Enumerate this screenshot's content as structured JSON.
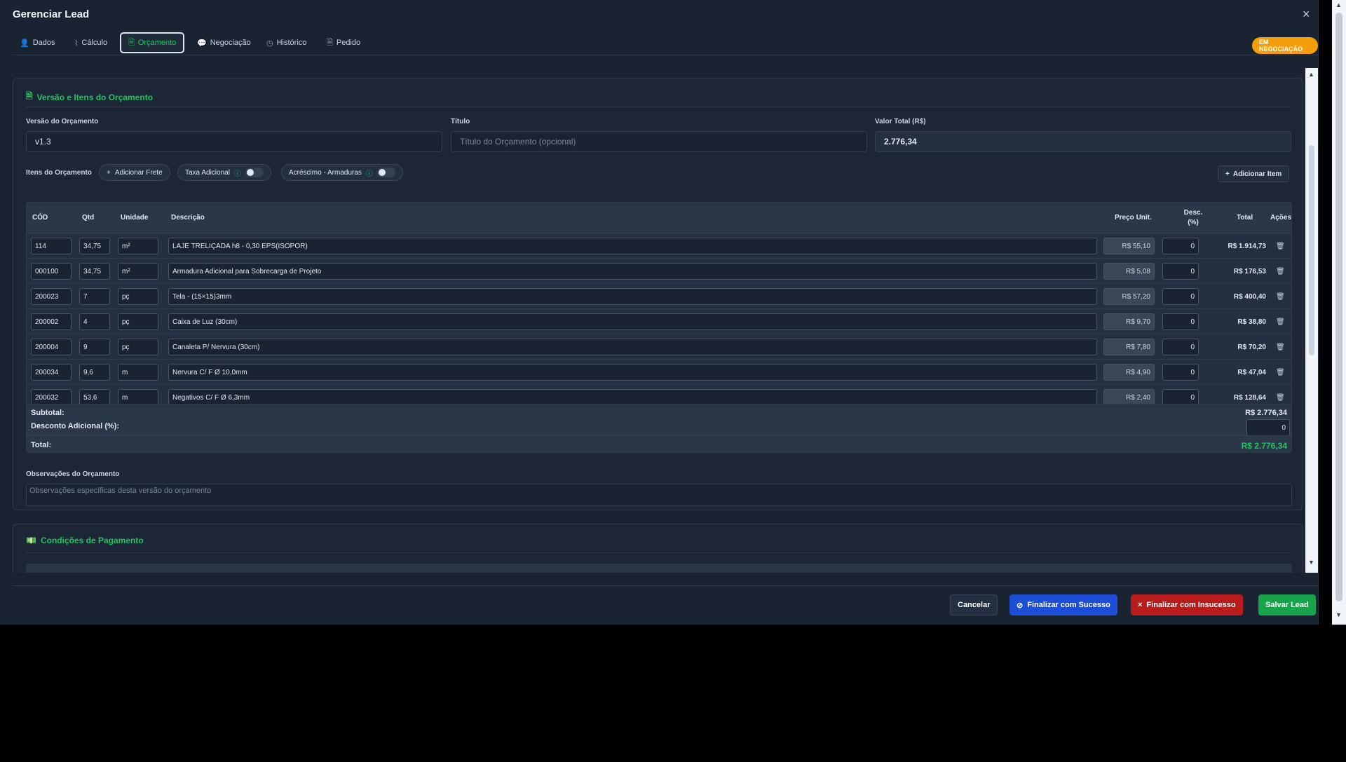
{
  "modal": {
    "title": "Gerenciar Lead",
    "close": "×"
  },
  "tabs": [
    {
      "label": "Dados",
      "icon": "👤"
    },
    {
      "label": "Cálculo",
      "icon": "⌇"
    },
    {
      "label": "Orçamento",
      "icon": "🗎"
    },
    {
      "label": "Negociação",
      "icon": "💬"
    },
    {
      "label": "Histórico",
      "icon": "◷"
    },
    {
      "label": "Pedido",
      "icon": "🗎"
    }
  ],
  "status_badge": "EM NEGOCIAÇÃO",
  "budget": {
    "section_title": "Versão e Itens do Orçamento",
    "version_label": "Versão do Orçamento",
    "version_value": "v1.3",
    "title_label": "Título",
    "title_placeholder": "Título do Orçamento (opcional)",
    "total_label": "Valor Total (R$)",
    "total_value": "2.776,34",
    "items_label": "Itens do Orçamento",
    "add_freight": "Adicionar Frete",
    "extra_fee": "Taxa Adicional",
    "surcharge": "Acréscimo - Armaduras",
    "add_item": "Adicionar Item"
  },
  "table": {
    "headers": {
      "cod": "CÓD",
      "qtd": "Qtd",
      "unidade": "Unidade",
      "descricao": "Descrição",
      "preco": "Preço Unit.",
      "desc": "Desc. (%)",
      "total": "Total",
      "acoes": "Ações"
    },
    "rows": [
      {
        "cod": "114",
        "qtd": "34,75",
        "un": "m²",
        "desc": "LAJE TRELIÇADA h8 - 0,30 EPS(ISOPOR)",
        "preco": "R$ 55,10",
        "disc": "0",
        "total": "R$ 1.914,73"
      },
      {
        "cod": "000100",
        "qtd": "34,75",
        "un": "m²",
        "desc": "Armadura Adicional para Sobrecarga de Projeto",
        "preco": "R$ 5,08",
        "disc": "0",
        "total": "R$ 176,53"
      },
      {
        "cod": "200023",
        "qtd": "7",
        "un": "pç",
        "desc": "Tela - (15×15)3mm",
        "preco": "R$ 57,20",
        "disc": "0",
        "total": "R$ 400,40"
      },
      {
        "cod": "200002",
        "qtd": "4",
        "un": "pç",
        "desc": "Caixa de Luz (30cm)",
        "preco": "R$ 9,70",
        "disc": "0",
        "total": "R$ 38,80"
      },
      {
        "cod": "200004",
        "qtd": "9",
        "un": "pç",
        "desc": "Canaleta P/ Nervura (30cm)",
        "preco": "R$ 7,80",
        "disc": "0",
        "total": "R$ 70,20"
      },
      {
        "cod": "200034",
        "qtd": "9,6",
        "un": "m",
        "desc": "Nervura C/ F Ø 10,0mm",
        "preco": "R$ 4,90",
        "disc": "0",
        "total": "R$ 47,04"
      },
      {
        "cod": "200032",
        "qtd": "53,6",
        "un": "m",
        "desc": "Negativos C/ F Ø 6,3mm",
        "preco": "R$ 2,40",
        "disc": "0",
        "total": "R$ 128,64"
      }
    ]
  },
  "summary": {
    "subtotal_label": "Subtotal:",
    "subtotal_value": "R$ 2.776,34",
    "discount_label": "Desconto Adicional (%):",
    "discount_value": "0",
    "total_label": "Total:",
    "total_value": "R$ 2.776,34"
  },
  "notes": {
    "label": "Observações do Orçamento",
    "placeholder": "Observações específicas desta versão do orçamento"
  },
  "payment": {
    "section_title": "Condições de Pagamento"
  },
  "footer": {
    "cancel": "Cancelar",
    "success": "Finalizar com Sucesso",
    "failure": "Finalizar com Insucesso",
    "save": "Salvar Lead"
  },
  "colors": {
    "accent": "#22c55e",
    "badge": "#f59e0b",
    "primary": "#1d4ed8",
    "danger": "#b91c1c",
    "save": "#16a34a"
  }
}
